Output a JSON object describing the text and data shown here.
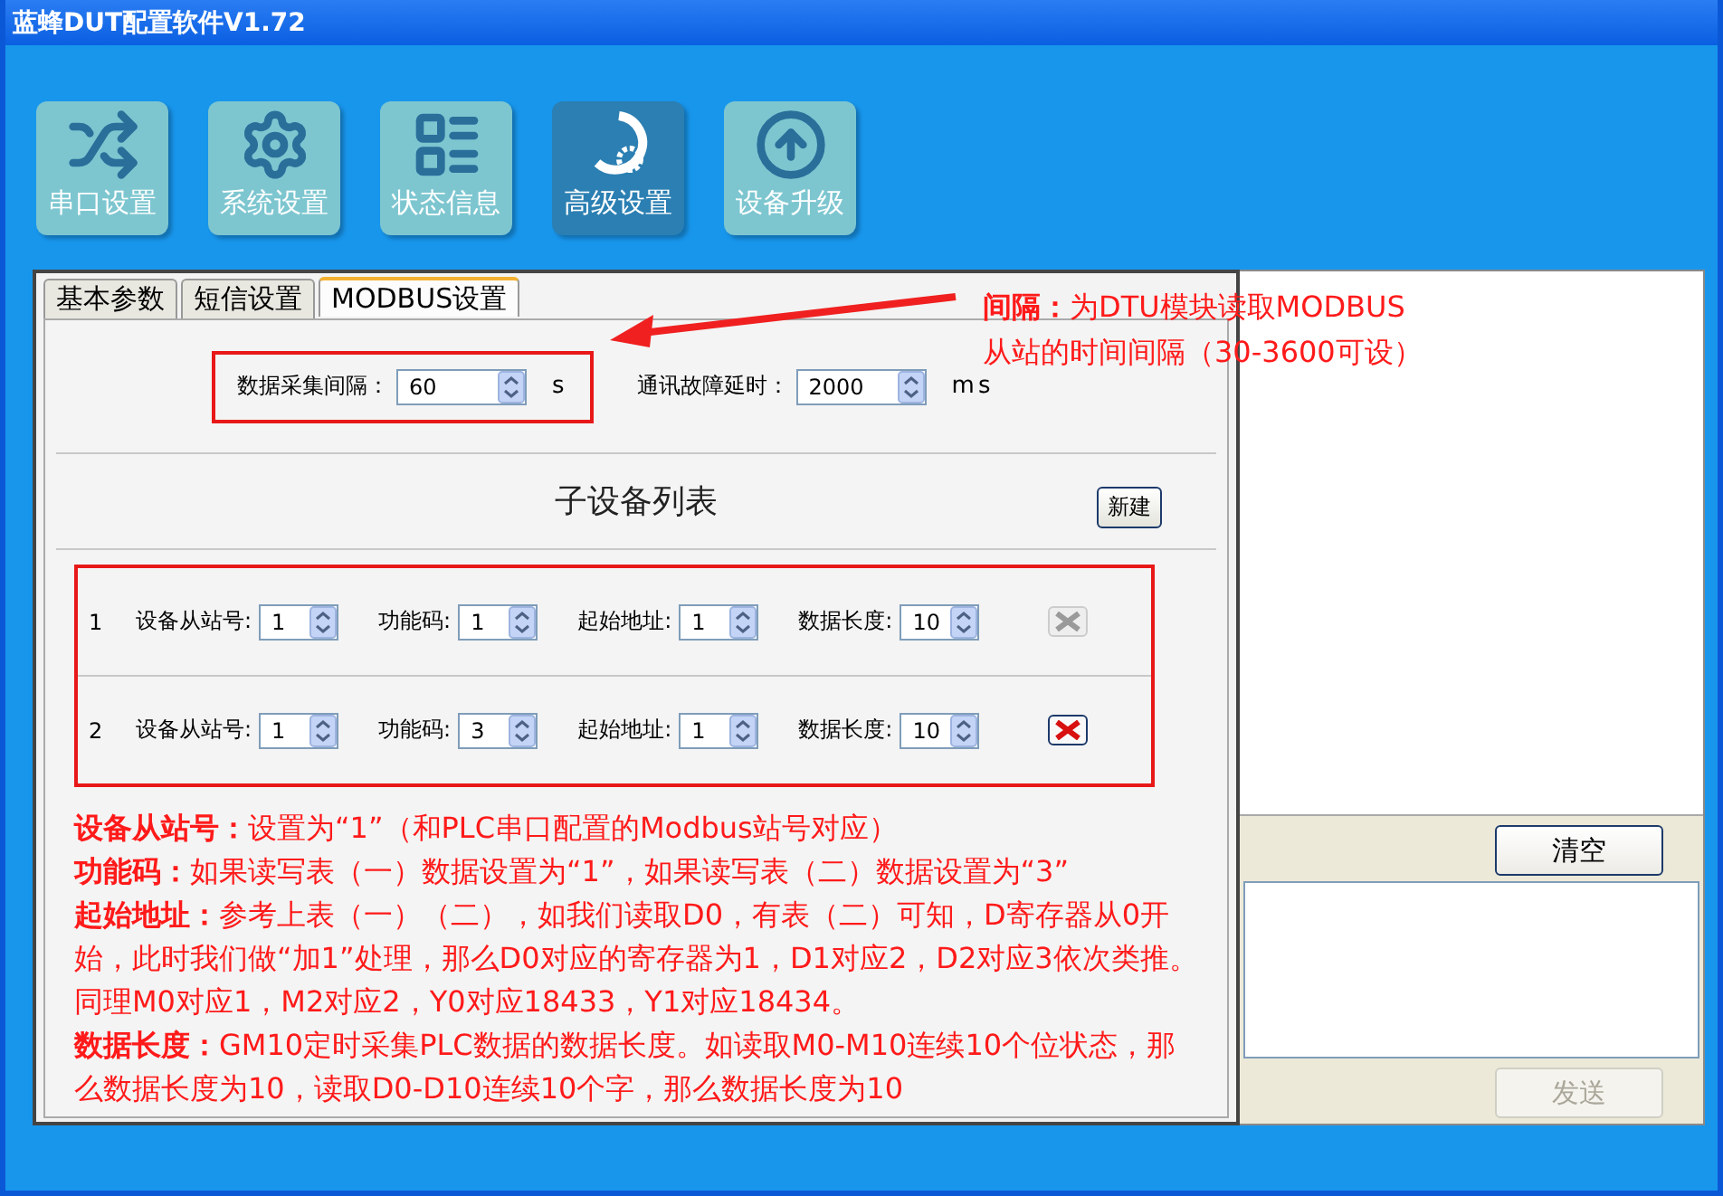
{
  "window": {
    "title": "蓝蜂DUT配置软件V1.72"
  },
  "toolbar": [
    {
      "label": "串口设置",
      "kind": "cross",
      "selected": false
    },
    {
      "label": "系统设置",
      "kind": "gear",
      "selected": false
    },
    {
      "label": "状态信息",
      "kind": "list",
      "selected": false
    },
    {
      "label": "高级设置",
      "kind": "advanced",
      "selected": true
    },
    {
      "label": "设备升级",
      "kind": "upgrade",
      "selected": false
    }
  ],
  "tabs": [
    {
      "label": "基本参数",
      "selected": false
    },
    {
      "label": "短信设置",
      "selected": false
    },
    {
      "label": "MODBUS设置",
      "selected": true
    }
  ],
  "settings": [
    {
      "label": "数据采集间隔：",
      "value": "60",
      "unit": "s",
      "highlighted": true
    },
    {
      "label": "通讯故障延时：",
      "value": "2000",
      "unit": "ms",
      "highlighted": false
    }
  ],
  "device_list": {
    "title": "子设备列表",
    "new_button": "新建",
    "highlighted": true,
    "rows": [
      {
        "index": "1",
        "fields": [
          {
            "label": "设备从站号:",
            "value": "1"
          },
          {
            "label": "功能码:",
            "value": "1"
          },
          {
            "label": "起始地址:",
            "value": "1"
          },
          {
            "label": "数据长度:",
            "value": "10"
          }
        ],
        "delete_disabled": true
      },
      {
        "index": "2",
        "fields": [
          {
            "label": "设备从站号:",
            "value": "1"
          },
          {
            "label": "功能码:",
            "value": "3"
          },
          {
            "label": "起始地址:",
            "value": "1"
          },
          {
            "label": "数据长度:",
            "value": "10"
          }
        ],
        "delete_disabled": false
      }
    ]
  },
  "notes": [
    "**设备从站号：**设置为“1”（和PLC串口配置的Modbus站号对应）",
    "**功能码：**如果读写表（一）数据设置为“1”，如果读写表（二）数据设置为“3”",
    "**起始地址：**参考上表（一）（二），如我们读取D0，有表（二）可知，D寄存器从0开始，此时我们做“加1”处理，那么D0对应的寄存器为1，D1对应2，D2对应3依次类推。同理M0对应1，M2对应2，Y0对应18433，Y1对应18434。",
    "**数据长度：**GM10定时采集PLC数据的数据长度。如读取M0-M10连续10个位状态，那么数据长度为10，读取D0-D10连续10个字，那么数据长度为10"
  ],
  "callout": [
    "**间隔：**为DTU模块读取MODBUS",
    "从站的时间间隔（30-3600可设）"
  ],
  "side_panel": {
    "clear_button": "清空",
    "send_button": {
      "label": "发送",
      "disabled": true
    }
  }
}
